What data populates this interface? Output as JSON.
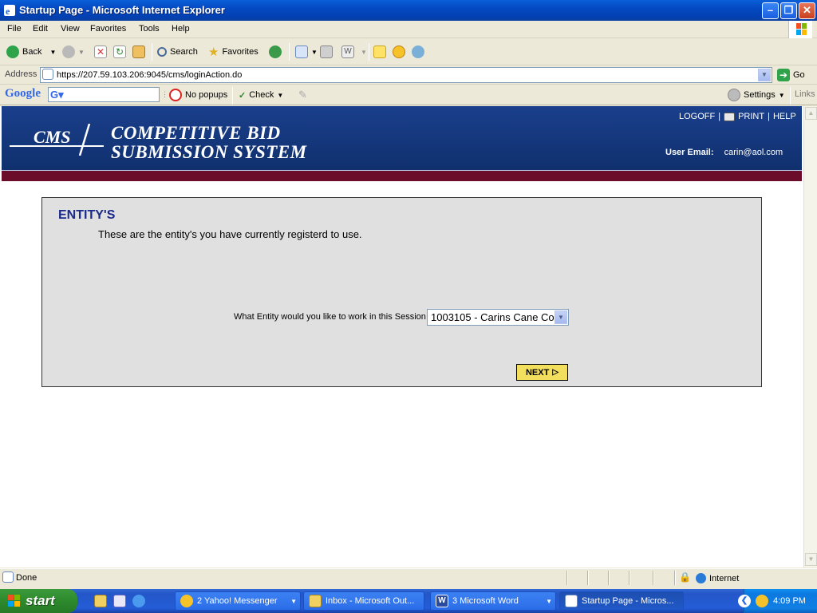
{
  "window": {
    "title": "Startup Page - Microsoft Internet Explorer"
  },
  "menu": [
    "File",
    "Edit",
    "View",
    "Favorites",
    "Tools",
    "Help"
  ],
  "toolbar": {
    "back": "Back",
    "search": "Search",
    "favorites": "Favorites"
  },
  "address": {
    "label": "Address",
    "url": "https://207.59.103.206:9045/cms/loginAction.do",
    "go": "Go"
  },
  "googlebar": {
    "logo": "Google",
    "popups": "No popups",
    "check": "Check",
    "settings": "Settings",
    "links": "Links"
  },
  "page": {
    "logo_text": "CMS",
    "system_title_line1": "COMPETITIVE BID",
    "system_title_line2": "SUBMISSION SYSTEM",
    "logoff": "LOGOFF",
    "sep": "|",
    "print": "PRINT",
    "help": "HELP",
    "user_email_label": "User Email:",
    "user_email": "carin@aol.com",
    "heading": "ENTITY'S",
    "description": "These are the entity's you have currently registerd to use.",
    "question": "What Entity would you like to work in this Session",
    "entity_selected": "1003105 - Carins Cane Co",
    "next": "NEXT"
  },
  "status": {
    "text": "Done",
    "zone": "Internet"
  },
  "taskbar": {
    "start": "start",
    "tasks": [
      "2 Yahoo! Messenger",
      "Inbox - Microsoft Out...",
      "3 Microsoft Word",
      "Startup Page - Micros..."
    ],
    "clock": "4:09 PM"
  },
  "colors": {
    "banner": "#1a3f8c",
    "stripe": "#6b0c2a",
    "heading": "#1a2a8a",
    "next_button": "#f3df5e",
    "panel": "#e0e0e0"
  }
}
